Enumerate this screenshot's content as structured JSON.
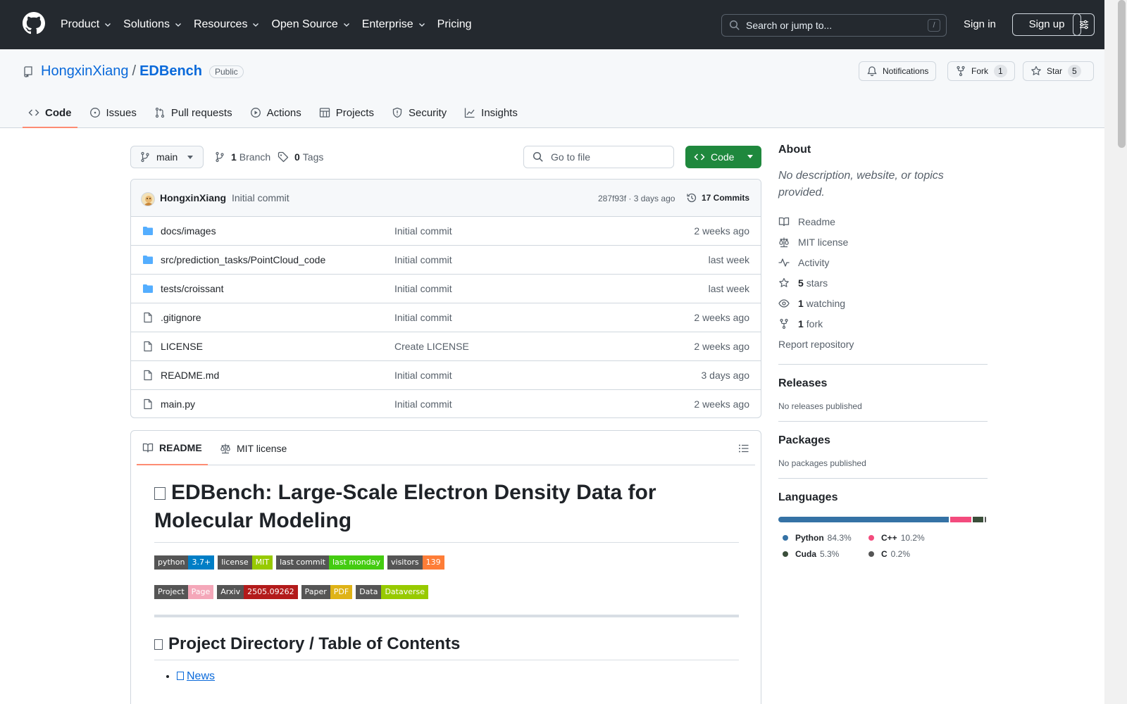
{
  "header": {
    "nav": [
      {
        "label": "Product",
        "dropdown": true
      },
      {
        "label": "Solutions",
        "dropdown": true
      },
      {
        "label": "Resources",
        "dropdown": true
      },
      {
        "label": "Open Source",
        "dropdown": true
      },
      {
        "label": "Enterprise",
        "dropdown": true
      },
      {
        "label": "Pricing",
        "dropdown": false
      }
    ],
    "search_placeholder": "Search or jump to...",
    "search_shortcut": "/",
    "signin": "Sign in",
    "signup": "Sign up"
  },
  "repo": {
    "owner": "HongxinXiang",
    "separator": "/",
    "name": "EDBench",
    "visibility": "Public",
    "notifications": "Notifications",
    "fork_label": "Fork",
    "fork_count": "1",
    "star_label": "Star",
    "star_count": "5",
    "tabs": [
      {
        "label": "Code",
        "icon": "code-icon",
        "active": true
      },
      {
        "label": "Issues",
        "icon": "issue-icon",
        "active": false
      },
      {
        "label": "Pull requests",
        "icon": "pull-request-icon",
        "active": false
      },
      {
        "label": "Actions",
        "icon": "play-icon",
        "active": false
      },
      {
        "label": "Projects",
        "icon": "table-icon",
        "active": false
      },
      {
        "label": "Security",
        "icon": "shield-icon",
        "active": false
      },
      {
        "label": "Insights",
        "icon": "graph-icon",
        "active": false
      }
    ]
  },
  "toolbar": {
    "branch": "main",
    "branch_count": "1",
    "branch_label": "Branch",
    "tag_count": "0",
    "tag_label": "Tags",
    "goto_placeholder": "Go to file",
    "code_button": "Code"
  },
  "latest_commit": {
    "author": "HongxinXiang",
    "message": "Initial commit",
    "sha_time": "287f93f · 3 days ago",
    "commits": "17 Commits"
  },
  "files": [
    {
      "name": "docs/images",
      "type": "folder",
      "message": "Initial commit",
      "time": "2 weeks ago"
    },
    {
      "name": "src/prediction_tasks/PointCloud_code",
      "type": "folder",
      "message": "Initial commit",
      "time": "last week"
    },
    {
      "name": "tests/croissant",
      "type": "folder",
      "message": "Initial commit",
      "time": "last week"
    },
    {
      "name": ".gitignore",
      "type": "file",
      "message": "Initial commit",
      "time": "2 weeks ago"
    },
    {
      "name": "LICENSE",
      "type": "file",
      "message": "Create LICENSE",
      "time": "2 weeks ago"
    },
    {
      "name": "README.md",
      "type": "file",
      "message": "Initial commit",
      "time": "3 days ago"
    },
    {
      "name": "main.py",
      "type": "file",
      "message": "Initial commit",
      "time": "2 weeks ago"
    }
  ],
  "readme": {
    "tab_readme": "README",
    "tab_license": "MIT license",
    "title": "EDBench: Large-Scale Electron Density Data for Molecular Modeling",
    "badges_row1": [
      {
        "left": "python",
        "right": "3.7+",
        "color": "#007ec6"
      },
      {
        "left": "license",
        "right": "MIT",
        "color": "#97ca00"
      },
      {
        "left": "last commit",
        "right": "last monday",
        "color": "#4c1"
      },
      {
        "left": "visitors",
        "right": "139",
        "color": "#fe7d37"
      }
    ],
    "badges_row2": [
      {
        "left": "Project",
        "right": "Page",
        "color": "#f4a7b9"
      },
      {
        "left": "Arxiv",
        "right": "2505.09262",
        "color": "#b31b1b"
      },
      {
        "left": "Paper",
        "right": "PDF",
        "color": "#dfb317"
      },
      {
        "left": "Data",
        "right": "Dataverse",
        "color": "#97ca00"
      }
    ],
    "h2": "Project Directory / Table of Contents",
    "toc": [
      "News"
    ]
  },
  "sidebar": {
    "about_title": "About",
    "about_desc": "No description, website, or topics provided.",
    "items": [
      {
        "icon": "book-icon",
        "bold": "",
        "text": "Readme"
      },
      {
        "icon": "law-icon",
        "bold": "",
        "text": "MIT license"
      },
      {
        "icon": "pulse-icon",
        "bold": "",
        "text": "Activity"
      },
      {
        "icon": "star-icon",
        "bold": "5",
        "text": "stars"
      },
      {
        "icon": "eye-icon",
        "bold": "1",
        "text": "watching"
      },
      {
        "icon": "fork-icon",
        "bold": "1",
        "text": "fork"
      }
    ],
    "report": "Report repository",
    "releases_title": "Releases",
    "releases_text": "No releases published",
    "packages_title": "Packages",
    "packages_text": "No packages published",
    "languages_title": "Languages",
    "languages": [
      {
        "name": "Python",
        "pct": "84.3%",
        "value": 84.3,
        "color": "#3572A5"
      },
      {
        "name": "C++",
        "pct": "10.2%",
        "value": 10.2,
        "color": "#f34b7d"
      },
      {
        "name": "Cuda",
        "pct": "5.3%",
        "value": 5.3,
        "color": "#3A4E3A"
      },
      {
        "name": "C",
        "pct": "0.2%",
        "value": 0.2,
        "color": "#555555"
      }
    ]
  }
}
